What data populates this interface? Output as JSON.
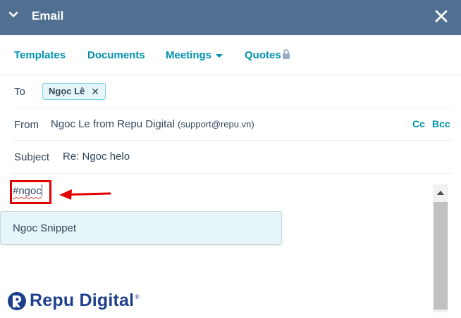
{
  "header": {
    "title": "Email"
  },
  "tabs": [
    {
      "label": "Templates"
    },
    {
      "label": "Documents"
    },
    {
      "label": "Meetings"
    },
    {
      "label": "Quotes"
    }
  ],
  "to": {
    "label": "To",
    "recipient": "Ngọc Lê"
  },
  "from": {
    "label": "From",
    "name": "Ngoc Le from Repu Digital",
    "email": "(support@repu.vn)",
    "cc": "Cc",
    "bcc": "Bcc"
  },
  "subject": {
    "label": "Subject",
    "value": "Re: Ngoc helo"
  },
  "editor": {
    "typed_text": "#ngoc"
  },
  "snippet_dropdown": {
    "items": [
      {
        "label": "Ngoc Snippet"
      }
    ]
  },
  "signature": {
    "logo_text": "Repu Digital",
    "logo_mark": "®"
  },
  "colors": {
    "header_bg": "#516f90",
    "link": "#0091ae",
    "highlight": "#e30000",
    "dropdown_bg": "#e5f5f8",
    "logo": "#1c3f8c"
  }
}
